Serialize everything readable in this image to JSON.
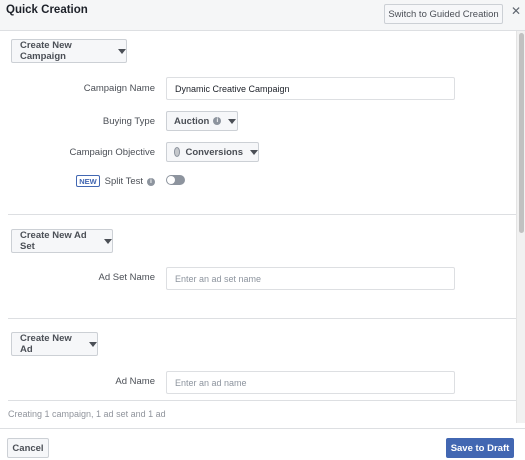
{
  "header": {
    "title": "Quick Creation",
    "guided_button": "Switch to Guided Creation",
    "close_icon": "close-icon"
  },
  "campaign": {
    "create_button": "Create New Campaign",
    "name_label": "Campaign Name",
    "name_value": "Dynamic Creative Campaign",
    "buying_type_label": "Buying Type",
    "buying_type_value": "Auction",
    "objective_label": "Campaign Objective",
    "objective_value": "Conversions",
    "new_badge": "NEW",
    "split_test_label": "Split Test",
    "split_test_enabled": false
  },
  "ad_set": {
    "create_button": "Create New Ad Set",
    "name_label": "Ad Set Name",
    "name_placeholder": "Enter an ad set name"
  },
  "ad": {
    "create_button": "Create New Ad",
    "name_label": "Ad Name",
    "name_placeholder": "Enter an ad name"
  },
  "footer": {
    "summary": "Creating 1 campaign, 1 ad set and 1 ad",
    "cancel": "Cancel",
    "save": "Save to Draft"
  },
  "colors": {
    "primary": "#4267b2",
    "header_bg": "#f5f6f7",
    "border": "#dddfe2"
  }
}
